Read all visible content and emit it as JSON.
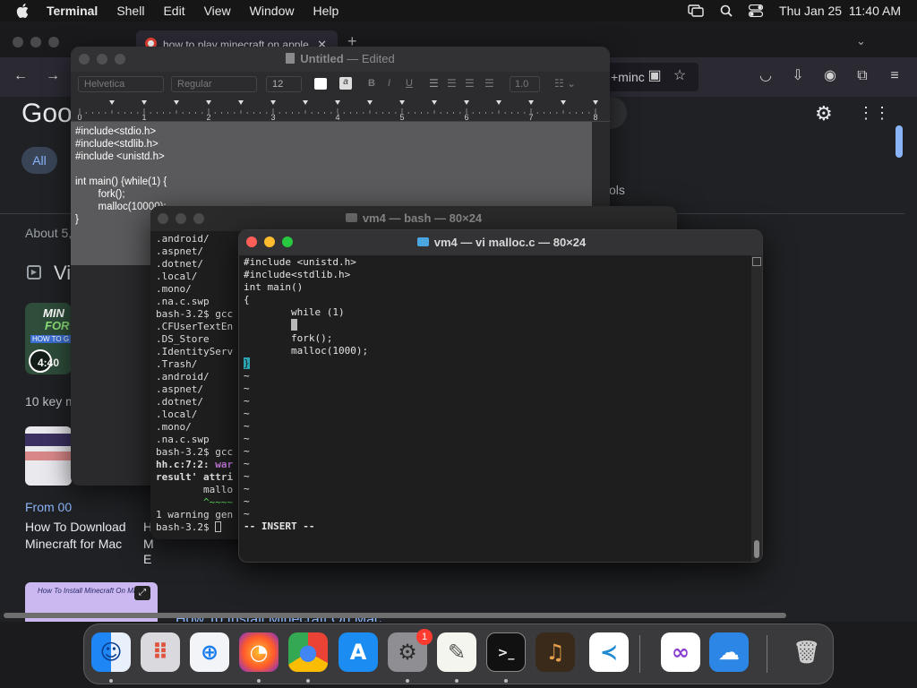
{
  "menubar": {
    "app": "Terminal",
    "items": [
      "Shell",
      "Edit",
      "View",
      "Window",
      "Help"
    ],
    "clock": "Thu Jan 25  11:40 AM"
  },
  "browser": {
    "tab_title": "how to play minecraft on apple",
    "url_fragment": "+minc",
    "google_logo": "Goo",
    "filter_all": "All",
    "tools_fragment": "ols",
    "about": "About 5,",
    "videos_fragment": "Vi",
    "video_duration": "4:40",
    "thumb_line1": "MIN",
    "thumb_line2": "FOR",
    "thumb_line3": "HOW TO G",
    "key_moments": "10 key m",
    "from_fragment": "From 00",
    "result1_line1": "How To Download",
    "result1_line2": "Minecraft for Mac",
    "result2_fragment1": "H",
    "result2_fragment2": "M",
    "result2_fragment3": "E",
    "install_thumb_text": "How To Install Minecraft On Mac",
    "install_link": "How To Install Minecraft On Mac",
    "accent_color": "#8ab4f8"
  },
  "textedit": {
    "title": "Untitled",
    "edited": "— Edited",
    "font_family": "Helvetica",
    "font_style": "Regular",
    "font_size": "12",
    "spacing": "1.0",
    "ruler_numbers": [
      "0",
      "1",
      "2",
      "3",
      "4",
      "5",
      "6",
      "7",
      "8"
    ],
    "document": "#include<stdio.h>\n#include<stdlib.h>\n#include <unistd.h>\n\nint main() {while(1) {\n        fork();\n        malloc(10000);\n}"
  },
  "bash_window": {
    "title": "vm4 — bash — 80×24",
    "lines": [
      ".android/",
      ".aspnet/",
      ".dotnet/",
      ".local/",
      ".mono/",
      ".na.c.swp",
      "bash-3.2$ gcc",
      ".CFUserTextEn",
      ".DS_Store",
      ".IdentityServ",
      ".Trash/",
      ".android/",
      ".aspnet/",
      ".dotnet/",
      ".local/",
      ".mono/",
      ".na.c.swp",
      "bash-3.2$ gcc",
      "hh.c:7:2: war",
      "result' attri",
      "        mallo",
      "        ^~~~~",
      "1 warning gen",
      "bash-3.2$ "
    ]
  },
  "vi_window": {
    "title": "vm4 — vi malloc.c — 80×24",
    "lines": [
      "#include <unistd.h>",
      "#include<stdlib.h>",
      "",
      "",
      "int main()",
      "{",
      "        while (1)",
      "",
      "        fork();",
      "        malloc(1000);",
      "}",
      "",
      "~",
      "~",
      "~",
      "~",
      "~",
      "~",
      "~",
      "~",
      "~",
      "~",
      "~",
      "~"
    ],
    "status": "-- INSERT --"
  },
  "dock": {
    "apps": [
      "finder",
      "launchpad",
      "safari",
      "firefox",
      "chrome",
      "app-store",
      "system-settings",
      "textedit",
      "terminal",
      "instruments",
      "vscode",
      "visual-studio",
      "weather",
      "trash"
    ],
    "settings_badge": "1"
  }
}
